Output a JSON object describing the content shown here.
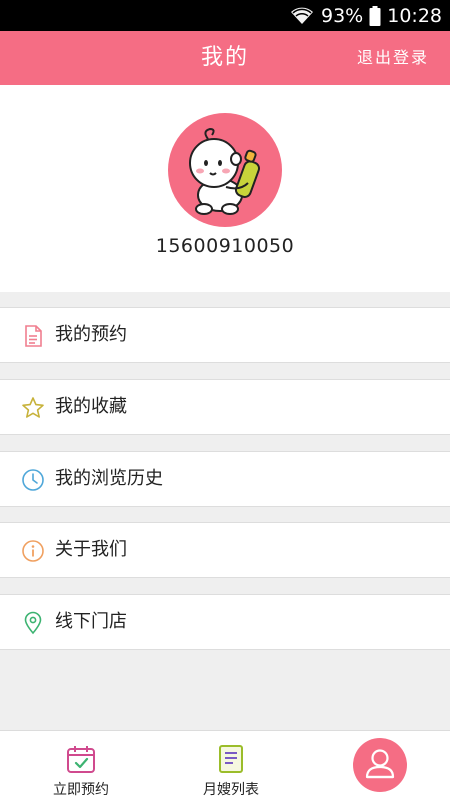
{
  "status_bar": {
    "battery": "93%",
    "time": "10:28"
  },
  "header": {
    "title": "我的",
    "logout_label": "退出登录"
  },
  "profile": {
    "phone": "15600910050"
  },
  "menu": {
    "items": [
      {
        "label": "我的预约",
        "icon": "document-icon",
        "color": "#f07f8f"
      },
      {
        "label": "我的收藏",
        "icon": "star-icon",
        "color": "#c7b23a"
      },
      {
        "label": "我的浏览历史",
        "icon": "clock-icon",
        "color": "#4fa7d9"
      },
      {
        "label": "关于我们",
        "icon": "info-icon",
        "color": "#f0a060"
      },
      {
        "label": "线下门店",
        "icon": "location-pin-icon",
        "color": "#3cb371"
      }
    ]
  },
  "bottom_nav": {
    "tabs": [
      {
        "label": "立即预约",
        "icon": "calendar-check-icon"
      },
      {
        "label": "月嫂列表",
        "icon": "list-document-icon"
      },
      {
        "icon": "user-icon",
        "active": true
      }
    ]
  },
  "colors": {
    "brand_pink": "#f56d84"
  }
}
